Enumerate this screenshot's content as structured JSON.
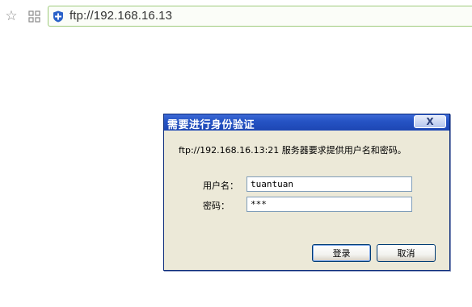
{
  "browser": {
    "address": "ftp://192.168.16.13",
    "icons": [
      "star-icon",
      "apps-grid-icon",
      "shield-icon"
    ]
  },
  "dialog": {
    "title": "需要进行身份验证",
    "close_label": "X",
    "message": "ftp://192.168.16.13:21 服务器要求提供用户名和密码。",
    "username_label": "用户名：",
    "username_value": "tuantuan",
    "password_label": "密码：",
    "password_value": "***",
    "login_label": "登录",
    "cancel_label": "取消"
  },
  "colors": {
    "titlebar": "#2654c5",
    "dialog_bg": "#ece9d8",
    "shield": "#2a62c9"
  }
}
